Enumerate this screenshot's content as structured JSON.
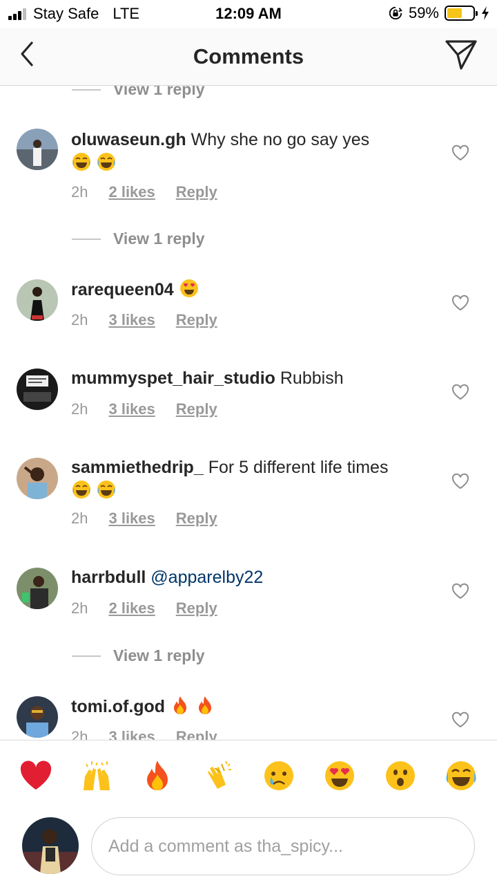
{
  "status_bar": {
    "carrier": "Stay Safe",
    "network": "LTE",
    "time": "12:09 AM",
    "battery_percent": "59%",
    "battery_level": 0.59,
    "battery_color": "#f5c518"
  },
  "nav": {
    "title": "Comments",
    "back_icon": "chevron-left-icon",
    "share_icon": "paper-plane-icon"
  },
  "view_reply_label": "View 1 reply",
  "comments": [
    {
      "username": "oluwaseun.gh",
      "text": "Why she no go say yes",
      "emoji": [
        "face-with-tears-of-joy",
        "face-with-tears-of-joy"
      ],
      "time": "2h",
      "likes": "2 likes",
      "reply": "Reply"
    },
    {
      "username": "rarequeen04",
      "text": "",
      "emoji": [
        "smiling-face-with-heart-eyes"
      ],
      "time": "2h",
      "likes": "3 likes",
      "reply": "Reply"
    },
    {
      "username": "mummyspet_hair_studio",
      "text": "Rubbish",
      "emoji": [],
      "time": "2h",
      "likes": "3 likes",
      "reply": "Reply"
    },
    {
      "username": "sammiethedrip_",
      "text": "For 5 different life times",
      "emoji": [
        "face-with-tears-of-joy",
        "face-with-tears-of-joy"
      ],
      "time": "2h",
      "likes": "3 likes",
      "reply": "Reply"
    },
    {
      "username": "harrbdull",
      "text": "@apparelby22",
      "emoji": [],
      "time": "2h",
      "likes": "2 likes",
      "reply": "Reply"
    },
    {
      "username": "tomi.of.god",
      "text": "",
      "emoji": [
        "fire",
        "fire"
      ],
      "time": "2h",
      "likes": "3 likes",
      "reply": "Reply"
    }
  ],
  "reactions": [
    "red-heart",
    "raising-hands",
    "fire",
    "clapping-hands",
    "crying-face",
    "smiling-face-with-heart-eyes",
    "face-with-open-mouth",
    "face-with-tears-of-joy"
  ],
  "composer": {
    "placeholder": "Add a comment as tha_spicy..."
  },
  "colors": {
    "mention": "#003569",
    "meta_gray": "#999999"
  }
}
